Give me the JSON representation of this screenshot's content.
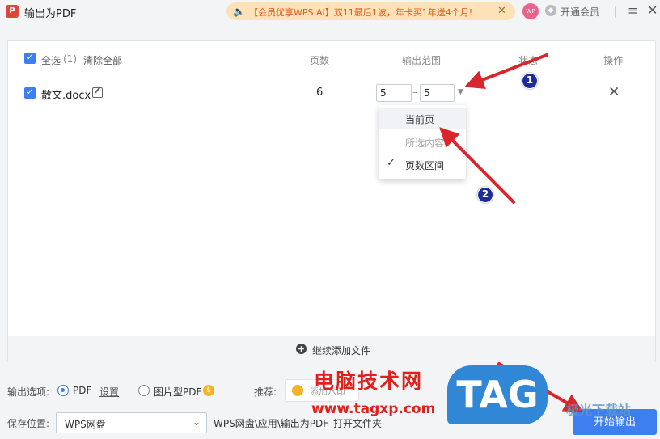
{
  "window": {
    "app_icon": "P",
    "title": "输出为PDF",
    "promo_text": "【会员优享WPS AI】双11最后1波，年卡买1年送4个月!",
    "promo_close": "✕",
    "avatar_text": "WP",
    "vip_label": "开通会员",
    "menu_glyph": "≡",
    "close_glyph": "✕"
  },
  "file_list": {
    "select_all_label": "全选",
    "select_count": "(1)",
    "clear_all_label": "清除全部",
    "columns": {
      "pages": "页数",
      "range": "输出范围",
      "status": "状态",
      "action": "操作"
    },
    "rows": [
      {
        "name": "散文.docx",
        "pages": "6",
        "range_from": "5",
        "range_to": "5",
        "range_sep": "–"
      }
    ],
    "range_dropdown": {
      "items": [
        {
          "label": "当前页",
          "state": "highlighted"
        },
        {
          "label": "所选内容",
          "state": "disabled"
        },
        {
          "label": "页数区间",
          "state": "selected"
        }
      ]
    },
    "add_files_label": "继续添加文件"
  },
  "options": {
    "output_label": "输出选项:",
    "pdf_label": "PDF",
    "settings_label": "设置",
    "image_pdf_label": "图片型PDF",
    "recommend_label": "推荐:",
    "ocr_label": "添加水印",
    "save_label": "保存位置:",
    "save_location": "WPS网盘",
    "save_path": "WPS网盘\\应用\\输出为PDF",
    "open_folder_label": "打开文件夹",
    "start_button": "开始输出"
  },
  "annotations": {
    "badge_1": "1",
    "badge_2": "2",
    "watermark_text": "电脑技术网",
    "watermark_url": "www.tagxp.com",
    "watermark_logo": "TAG",
    "watermark_right": "极光下载站"
  },
  "icons": {
    "speaker": "speaker-icon",
    "vip": "vip-icon",
    "edit": "edit-icon",
    "delete": "close-icon",
    "add": "plus-circle-icon",
    "check": "check-icon"
  },
  "colors": {
    "accent": "#3d7ef0",
    "promo_bg": "#fde2b8",
    "promo_text": "#e0571c",
    "annotation_arrow": "#d9262c",
    "annotation_badge": "#1d2a9c"
  }
}
